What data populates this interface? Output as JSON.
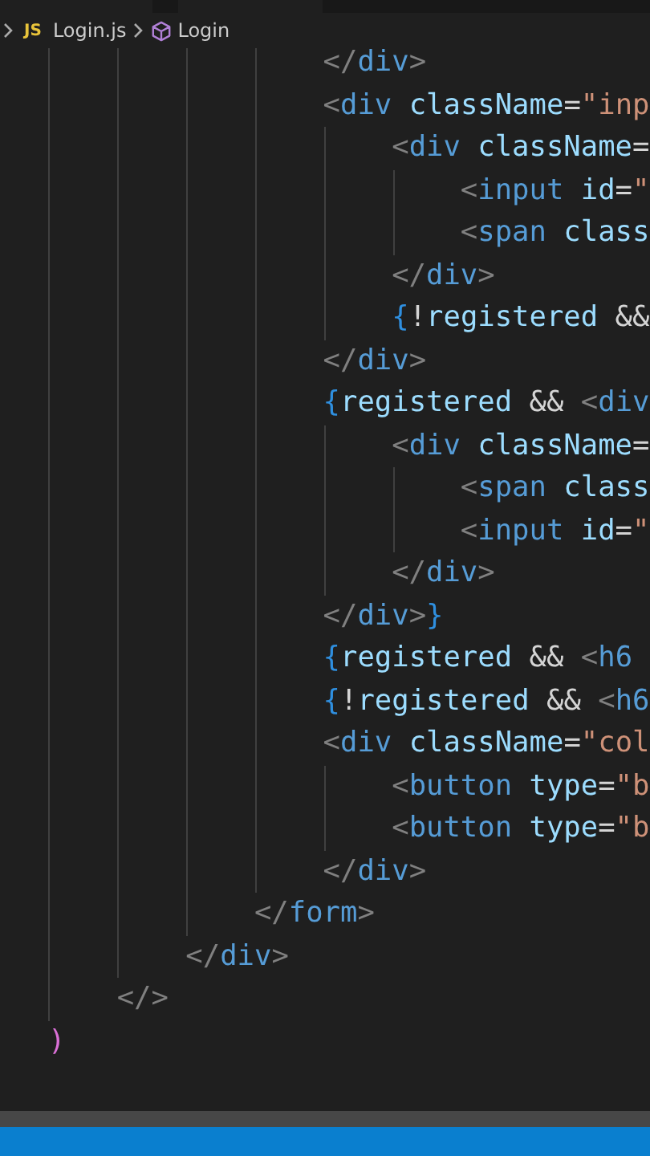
{
  "breadcrumb": {
    "file_badge": "JS",
    "file": "Login.js",
    "symbol": "Login"
  },
  "editor": {
    "lines": [
      {
        "tokens": [
          {
            "kind": "bracket",
            "text": "                </"
          },
          {
            "kind": "tag",
            "text": "div"
          },
          {
            "kind": "bracket",
            "text": ">"
          }
        ]
      },
      {
        "tokens": [
          {
            "kind": "bracket",
            "text": "                <"
          },
          {
            "kind": "tag",
            "text": "div"
          },
          {
            "kind": "attr",
            "text": " className"
          },
          {
            "kind": "plain",
            "text": "="
          },
          {
            "kind": "string",
            "text": "\"inp"
          }
        ]
      },
      {
        "tokens": [
          {
            "kind": "bracket",
            "text": "                    <"
          },
          {
            "kind": "tag",
            "text": "div"
          },
          {
            "kind": "attr",
            "text": " className"
          },
          {
            "kind": "plain",
            "text": "="
          }
        ]
      },
      {
        "tokens": [
          {
            "kind": "bracket",
            "text": "                        <"
          },
          {
            "kind": "tag",
            "text": "input"
          },
          {
            "kind": "attr",
            "text": " id"
          },
          {
            "kind": "plain",
            "text": "="
          },
          {
            "kind": "string",
            "text": "\""
          }
        ]
      },
      {
        "tokens": [
          {
            "kind": "bracket",
            "text": "                        <"
          },
          {
            "kind": "tag",
            "text": "span"
          },
          {
            "kind": "attr",
            "text": " class"
          }
        ]
      },
      {
        "tokens": [
          {
            "kind": "bracket",
            "text": "                    </"
          },
          {
            "kind": "tag",
            "text": "div"
          },
          {
            "kind": "bracket",
            "text": ">"
          }
        ]
      },
      {
        "tokens": [
          {
            "kind": "brace",
            "text": "                    {"
          },
          {
            "kind": "plain",
            "text": "!"
          },
          {
            "kind": "attr",
            "text": "registered"
          },
          {
            "kind": "plain",
            "text": " &&"
          }
        ]
      },
      {
        "tokens": [
          {
            "kind": "bracket",
            "text": "                </"
          },
          {
            "kind": "tag",
            "text": "div"
          },
          {
            "kind": "bracket",
            "text": ">"
          }
        ]
      },
      {
        "tokens": [
          {
            "kind": "brace",
            "text": "                {"
          },
          {
            "kind": "attr",
            "text": "registered"
          },
          {
            "kind": "plain",
            "text": " && "
          },
          {
            "kind": "bracket",
            "text": "<"
          },
          {
            "kind": "tag",
            "text": "div"
          }
        ]
      },
      {
        "tokens": [
          {
            "kind": "bracket",
            "text": "                    <"
          },
          {
            "kind": "tag",
            "text": "div"
          },
          {
            "kind": "attr",
            "text": " className"
          },
          {
            "kind": "plain",
            "text": "="
          }
        ]
      },
      {
        "tokens": [
          {
            "kind": "bracket",
            "text": "                        <"
          },
          {
            "kind": "tag",
            "text": "span"
          },
          {
            "kind": "attr",
            "text": " class"
          }
        ]
      },
      {
        "tokens": [
          {
            "kind": "bracket",
            "text": "                        <"
          },
          {
            "kind": "tag",
            "text": "input"
          },
          {
            "kind": "attr",
            "text": " id"
          },
          {
            "kind": "plain",
            "text": "="
          },
          {
            "kind": "string",
            "text": "\""
          }
        ]
      },
      {
        "tokens": [
          {
            "kind": "bracket",
            "text": "                    </"
          },
          {
            "kind": "tag",
            "text": "div"
          },
          {
            "kind": "bracket",
            "text": ">"
          }
        ]
      },
      {
        "tokens": [
          {
            "kind": "bracket",
            "text": "                </"
          },
          {
            "kind": "tag",
            "text": "div"
          },
          {
            "kind": "bracket",
            "text": ">"
          },
          {
            "kind": "brace",
            "text": "}"
          }
        ]
      },
      {
        "tokens": [
          {
            "kind": "brace",
            "text": "                {"
          },
          {
            "kind": "attr",
            "text": "registered"
          },
          {
            "kind": "plain",
            "text": " && "
          },
          {
            "kind": "bracket",
            "text": "<"
          },
          {
            "kind": "tag",
            "text": "h6"
          }
        ]
      },
      {
        "tokens": [
          {
            "kind": "brace",
            "text": "                {"
          },
          {
            "kind": "plain",
            "text": "!"
          },
          {
            "kind": "attr",
            "text": "registered"
          },
          {
            "kind": "plain",
            "text": " && "
          },
          {
            "kind": "bracket",
            "text": "<"
          },
          {
            "kind": "tag",
            "text": "h6"
          }
        ]
      },
      {
        "tokens": [
          {
            "kind": "bracket",
            "text": "                <"
          },
          {
            "kind": "tag",
            "text": "div"
          },
          {
            "kind": "attr",
            "text": " className"
          },
          {
            "kind": "plain",
            "text": "="
          },
          {
            "kind": "string",
            "text": "\"col"
          }
        ]
      },
      {
        "tokens": [
          {
            "kind": "bracket",
            "text": "                    <"
          },
          {
            "kind": "tag",
            "text": "button"
          },
          {
            "kind": "attr",
            "text": " type"
          },
          {
            "kind": "plain",
            "text": "="
          },
          {
            "kind": "string",
            "text": "\"b"
          }
        ]
      },
      {
        "tokens": [
          {
            "kind": "bracket",
            "text": "                    <"
          },
          {
            "kind": "tag",
            "text": "button"
          },
          {
            "kind": "attr",
            "text": " type"
          },
          {
            "kind": "plain",
            "text": "="
          },
          {
            "kind": "string",
            "text": "\"b"
          }
        ]
      },
      {
        "tokens": [
          {
            "kind": "bracket",
            "text": "                </"
          },
          {
            "kind": "tag",
            "text": "div"
          },
          {
            "kind": "bracket",
            "text": ">"
          }
        ]
      },
      {
        "tokens": [
          {
            "kind": "bracket",
            "text": "            </"
          },
          {
            "kind": "tag",
            "text": "form"
          },
          {
            "kind": "bracket",
            "text": ">"
          }
        ]
      },
      {
        "tokens": [
          {
            "kind": "bracket",
            "text": "        </"
          },
          {
            "kind": "tag",
            "text": "div"
          },
          {
            "kind": "bracket",
            "text": ">"
          }
        ]
      },
      {
        "tokens": [
          {
            "kind": "bracket",
            "text": "    </>"
          }
        ]
      },
      {
        "tokens": [
          {
            "kind": "paren",
            "text": ")"
          }
        ]
      }
    ]
  }
}
